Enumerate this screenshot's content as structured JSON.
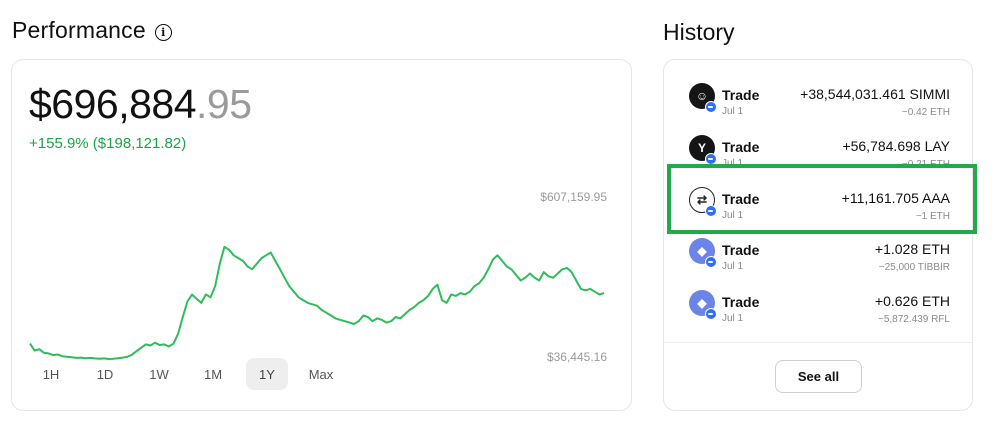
{
  "performance": {
    "title": "Performance",
    "info_icon": "info-icon",
    "balance_whole": "$696,884",
    "balance_cents": ".95",
    "change": "+155.9% ($198,121.82)",
    "axis_max_label": "$607,159.95",
    "axis_min_label": "$36,445.16",
    "ranges": [
      {
        "label": "1H",
        "active": false
      },
      {
        "label": "1D",
        "active": false
      },
      {
        "label": "1W",
        "active": false
      },
      {
        "label": "1M",
        "active": false
      },
      {
        "label": "1Y",
        "active": true
      },
      {
        "label": "Max",
        "active": false
      }
    ],
    "line_color": "#2ebd59"
  },
  "chart_data": {
    "type": "line",
    "ylim": [
      36445.16,
      607159.95
    ],
    "series": [
      {
        "values": [
          95000,
          70000,
          75000,
          62000,
          60000,
          54000,
          56000,
          50000,
          48000,
          46000,
          44000,
          45000,
          43000,
          44000,
          42000,
          41000,
          42000,
          40000,
          41000,
          43000,
          45000,
          48000,
          55000,
          68000,
          80000,
          92000,
          88000,
          98000,
          90000,
          92000,
          85000,
          95000,
          130000,
          190000,
          245000,
          270000,
          255000,
          240000,
          270000,
          260000,
          300000,
          380000,
          440000,
          430000,
          410000,
          400000,
          390000,
          370000,
          360000,
          380000,
          400000,
          410000,
          420000,
          390000,
          360000,
          330000,
          300000,
          280000,
          260000,
          250000,
          240000,
          235000,
          230000,
          215000,
          205000,
          195000,
          185000,
          180000,
          175000,
          170000,
          165000,
          175000,
          195000,
          190000,
          175000,
          185000,
          180000,
          170000,
          175000,
          190000,
          185000,
          200000,
          215000,
          225000,
          240000,
          250000,
          265000,
          290000,
          305000,
          250000,
          240000,
          270000,
          265000,
          275000,
          270000,
          280000,
          300000,
          310000,
          330000,
          360000,
          395000,
          410000,
          390000,
          370000,
          360000,
          340000,
          320000,
          330000,
          345000,
          330000,
          320000,
          350000,
          335000,
          330000,
          345000,
          360000,
          365000,
          350000,
          320000,
          290000,
          285000,
          290000,
          280000,
          270000,
          275000
        ]
      }
    ]
  },
  "history": {
    "title": "History",
    "rows": [
      {
        "kind": "Trade",
        "date": "Jul 1",
        "amount": "+38,544,031.461 SIMMI",
        "sub": "−0.42 ETH",
        "avatar_style": "dark",
        "icon": "simmi-token-icon",
        "glyph": "☺"
      },
      {
        "kind": "Trade",
        "date": "Jul 1",
        "amount": "+56,784.698 LAY",
        "sub": "−0.21 ETH",
        "avatar_style": "dark",
        "icon": "lay-token-icon",
        "glyph": "Y"
      },
      {
        "kind": "Trade",
        "date": "Jul 1",
        "amount": "+11,161.705 AAA",
        "sub": "−1 ETH",
        "avatar_style": "light",
        "icon": "swap-arrows-icon",
        "glyph": "⇄"
      },
      {
        "kind": "Trade",
        "date": "Jul 1",
        "amount": "+1.028 ETH",
        "sub": "−25,000 TIBBIR",
        "avatar_style": "eth",
        "icon": "ethereum-icon",
        "glyph": "◆"
      },
      {
        "kind": "Trade",
        "date": "Jul 1",
        "amount": "+0.626 ETH",
        "sub": "−5,872.439 RFL",
        "avatar_style": "eth",
        "icon": "ethereum-icon",
        "glyph": "◆"
      }
    ],
    "badge_icon": "chain-badge-icon",
    "see_all_label": "See all",
    "highlight_color": "#22a94a"
  }
}
